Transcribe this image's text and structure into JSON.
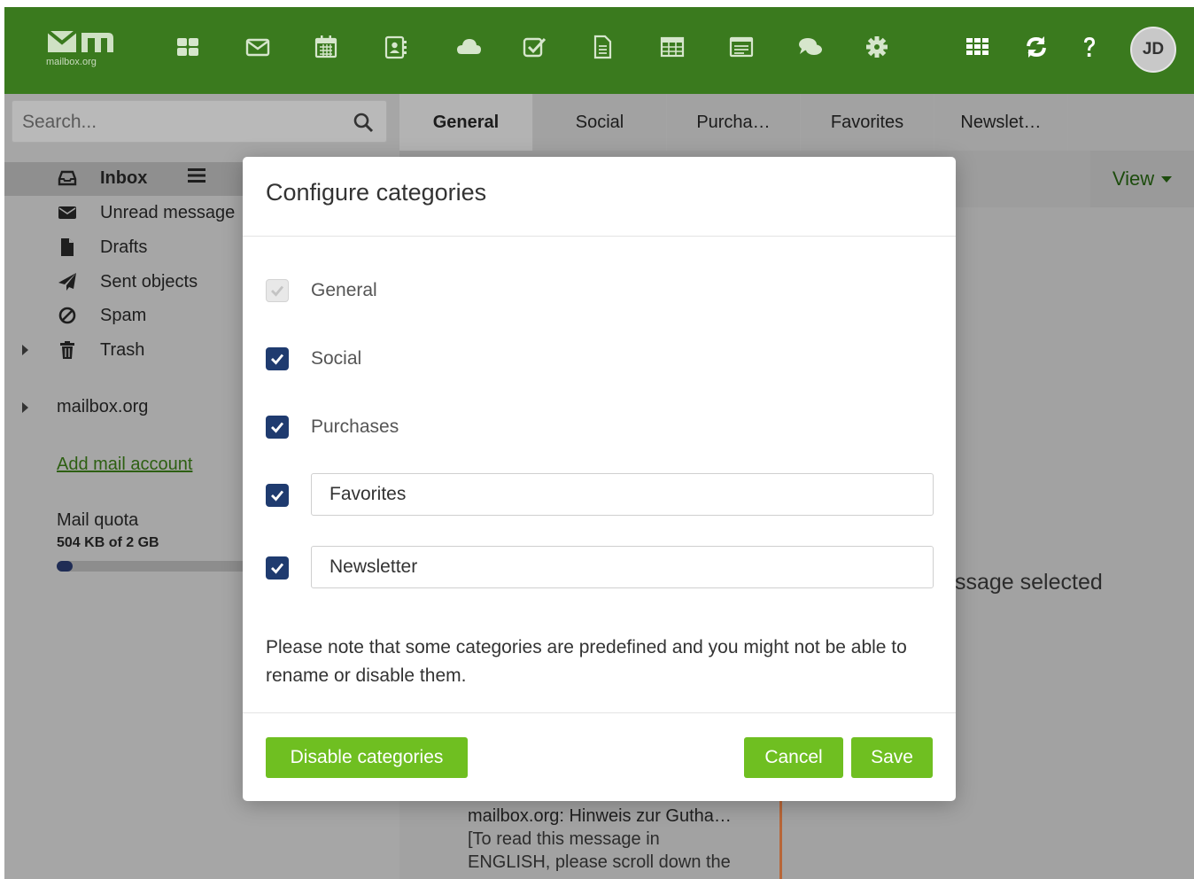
{
  "app": {
    "logo_text": "mailbox.org",
    "avatar_initials": "JD",
    "accent_color": "#3a7a1e",
    "button_color": "#6fbf21",
    "apps": [
      {
        "name": "portal-icon"
      },
      {
        "name": "mail-icon"
      },
      {
        "name": "calendar-icon"
      },
      {
        "name": "contacts-icon"
      },
      {
        "name": "drive-icon"
      },
      {
        "name": "tasks-icon"
      },
      {
        "name": "documents-icon"
      },
      {
        "name": "spreadsheet-icon"
      },
      {
        "name": "presentation-icon"
      },
      {
        "name": "chat-icon"
      },
      {
        "name": "settings-icon"
      }
    ]
  },
  "search": {
    "placeholder": "Search..."
  },
  "tabs": [
    {
      "label": "General",
      "active": true
    },
    {
      "label": "Social"
    },
    {
      "label": "Purcha…"
    },
    {
      "label": "Favorites"
    },
    {
      "label": "Newslet…"
    }
  ],
  "sidebar": {
    "folders": [
      {
        "label": "Inbox",
        "icon": "inbox-icon"
      },
      {
        "label": "Unread message",
        "icon": "envelope-icon"
      },
      {
        "label": "Drafts",
        "icon": "file-icon"
      },
      {
        "label": "Sent objects",
        "icon": "paper-plane-icon"
      },
      {
        "label": "Spam",
        "icon": "ban-icon"
      },
      {
        "label": "Trash",
        "icon": "trash-icon"
      }
    ],
    "account": "mailbox.org",
    "add_account": "Add mail account",
    "quota_label": "Mail quota",
    "quota_value": "504 KB of 2 GB",
    "quota_fraction": 0.08
  },
  "view_button": "View",
  "no_message": "ssage selected",
  "mail_preview": {
    "subject": "mailbox.org: Hinweis zur Gutha…",
    "line1": "[To read this message in",
    "line2": "ENGLISH, please scroll down the"
  },
  "dialog": {
    "title": "Configure categories",
    "categories": [
      {
        "label": "General",
        "checked": true,
        "editable": false,
        "locked": true
      },
      {
        "label": "Social",
        "checked": true,
        "editable": false
      },
      {
        "label": "Purchases",
        "checked": true,
        "editable": false
      },
      {
        "value": "Favorites",
        "checked": true,
        "editable": true
      },
      {
        "value": "Newsletter",
        "checked": true,
        "editable": true
      }
    ],
    "note": "Please note that some categories are predefined and you might not be able to rename or disable them.",
    "disable_button": "Disable categories",
    "cancel_button": "Cancel",
    "save_button": "Save"
  }
}
